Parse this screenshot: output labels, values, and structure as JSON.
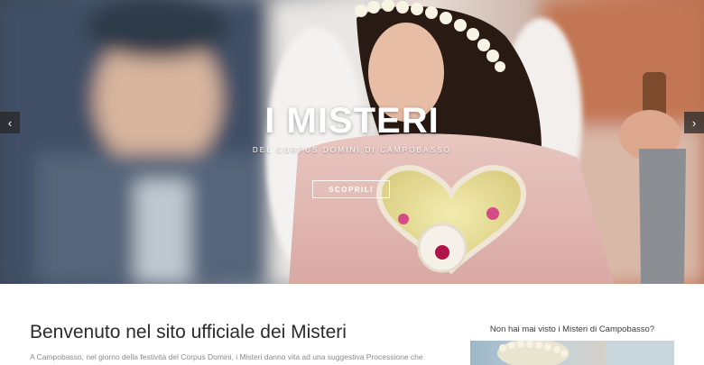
{
  "hero": {
    "title": "I MISTERI",
    "subtitle": "DEL CORPUS DOMINI DI CAMPOBASSO",
    "cta_label": "SCOPRILI",
    "prev_arrow": "‹",
    "next_arrow": "›"
  },
  "main": {
    "title": "Benvenuto nel sito ufficiale dei Misteri",
    "intro": "A Campobasso, nel giorno della festività del Corpus Domini, i Misteri danno vita ad una suggestiva Processione che"
  },
  "sidebar": {
    "question": "Non hai mai visto i Misteri di Campobasso?"
  },
  "icons": {
    "prev": "chevron-left-icon",
    "next": "chevron-right-icon"
  },
  "colors": {
    "hero_text": "#ffffff",
    "title_text": "#2b2b2b",
    "body_text": "#8a8a8a",
    "arrow_bg": "#282828"
  }
}
